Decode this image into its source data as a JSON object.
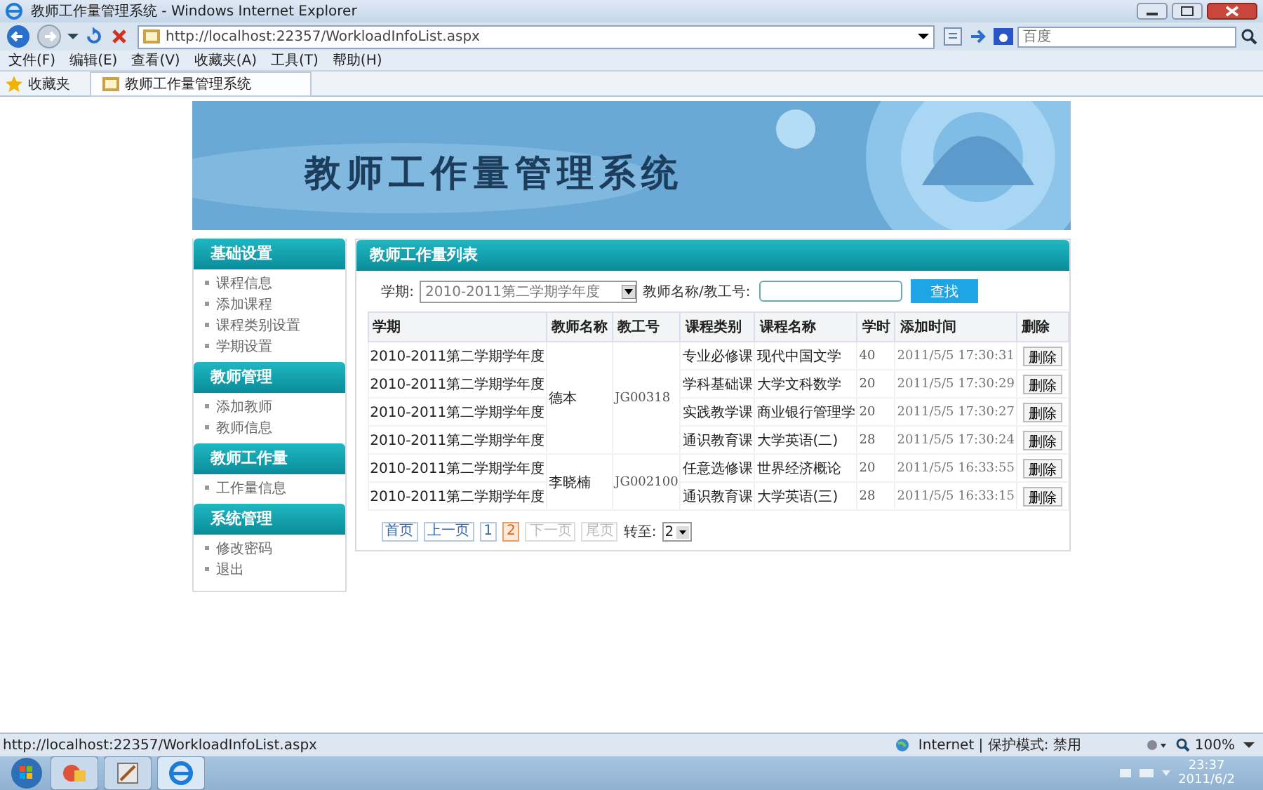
{
  "window": {
    "title": "教师工作量管理系统 - Windows Internet Explorer"
  },
  "address_bar": {
    "url": "http://localhost:22357/WorkloadInfoList.aspx"
  },
  "search_box": {
    "placeholder": "百度"
  },
  "menu_bar": [
    "文件(F)",
    "编辑(E)",
    "查看(V)",
    "收藏夹(A)",
    "工具(T)",
    "帮助(H)"
  ],
  "favorites_bar": {
    "label": "收藏夹",
    "tab": "教师工作量管理系统"
  },
  "banner": {
    "title": "教师工作量管理系统"
  },
  "sidebar": [
    {
      "title": "基础设置",
      "items": [
        "课程信息",
        "添加课程",
        "课程类别设置",
        "学期设置"
      ]
    },
    {
      "title": "教师管理",
      "items": [
        "添加教师",
        "教师信息"
      ]
    },
    {
      "title": "教师工作量",
      "items": [
        "工作量信息"
      ]
    },
    {
      "title": "系统管理",
      "items": [
        "修改密码",
        "退出"
      ]
    }
  ],
  "panel": {
    "title": "教师工作量列表",
    "filter": {
      "term_label": "学期:",
      "term_value": "2010-2011第二学期学年度",
      "name_label": "教师名称/教工号:",
      "search_button": "查找"
    },
    "table": {
      "columns": [
        "学期",
        "教师名称",
        "教工号",
        "课程类别",
        "课程名称",
        "学时",
        "添加时间",
        "删除"
      ],
      "groups": [
        {
          "teacher": "德本",
          "id": "JG00318",
          "rows": [
            {
              "term": "2010-2011第二学期学年度",
              "category": "专业必修课",
              "course": "现代中国文学",
              "hours": "40",
              "time": "2011/5/5 17:30:31",
              "action": "删除"
            },
            {
              "term": "2010-2011第二学期学年度",
              "category": "学科基础课",
              "course": "大学文科数学",
              "hours": "20",
              "time": "2011/5/5 17:30:29",
              "action": "删除"
            },
            {
              "term": "2010-2011第二学期学年度",
              "category": "实践教学课",
              "course": "商业银行管理学",
              "hours": "20",
              "time": "2011/5/5 17:30:27",
              "action": "删除"
            },
            {
              "term": "2010-2011第二学期学年度",
              "category": "通识教育课",
              "course": "大学英语(二)",
              "hours": "28",
              "time": "2011/5/5 17:30:24",
              "action": "删除"
            }
          ]
        },
        {
          "teacher": "李晓楠",
          "id": "JG002100",
          "rows": [
            {
              "term": "2010-2011第二学期学年度",
              "category": "任意选修课",
              "course": "世界经济概论",
              "hours": "20",
              "time": "2011/5/5 16:33:55",
              "action": "删除"
            },
            {
              "term": "2010-2011第二学期学年度",
              "category": "通识教育课",
              "course": "大学英语(三)",
              "hours": "28",
              "time": "2011/5/5 16:33:15",
              "action": "删除"
            }
          ]
        }
      ]
    },
    "pager": {
      "links": [
        {
          "label": "首页",
          "selected": false,
          "disabled": false
        },
        {
          "label": "上一页",
          "selected": false,
          "disabled": false
        },
        {
          "label": "1",
          "selected": false,
          "disabled": false
        },
        {
          "label": "2",
          "selected": true,
          "disabled": false
        },
        {
          "label": "下一页",
          "selected": false,
          "disabled": true
        },
        {
          "label": "尾页",
          "selected": false,
          "disabled": true
        }
      ],
      "goto_label": "转至:",
      "goto_value": "2"
    }
  },
  "status_bar": {
    "url": "http://localhost:22357/WorkloadInfoList.aspx",
    "zone": "Internet | 保护模式: 禁用",
    "zoom": "100%"
  },
  "taskbar": {
    "time": "23:37",
    "date": "2011/6/2"
  }
}
